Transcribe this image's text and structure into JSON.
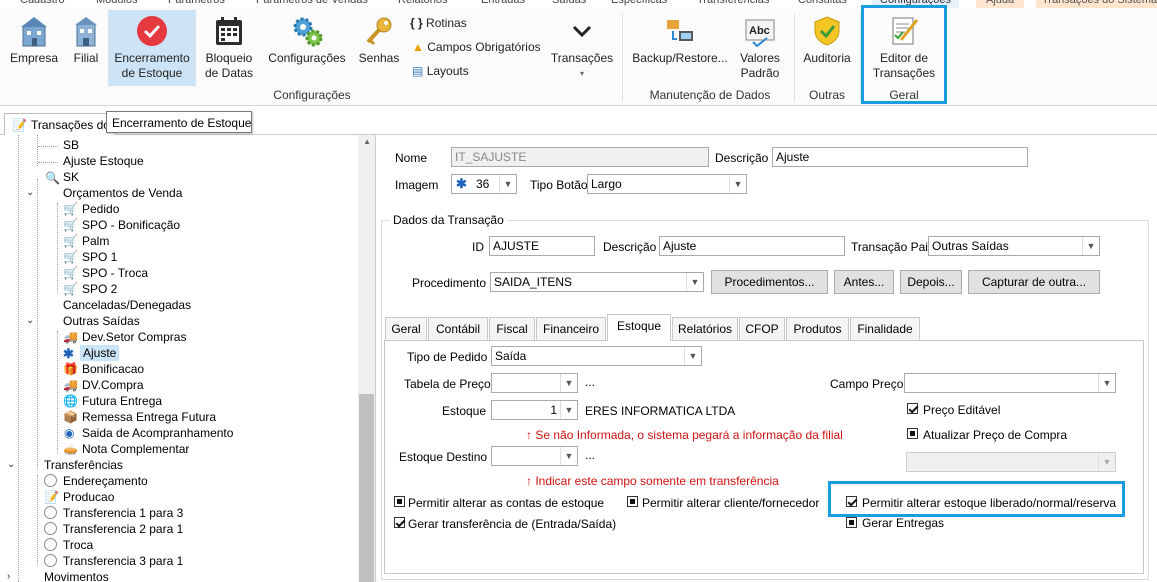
{
  "menu_tabs": [
    "Cadastro",
    "Módulos",
    "Parâmetros",
    "Parâmetros de Vendas",
    "Relatórios",
    "Entradas",
    "Saídas",
    "Específicas",
    "Transferências",
    "Consultas",
    "Configurações",
    "Ajuda",
    "Transações do Sistema"
  ],
  "ribbon": {
    "buttons": {
      "empresa": "Empresa",
      "filial": "Filial",
      "encerramento": [
        "Encerramento",
        "de Estoque"
      ],
      "bloqueio": [
        "Bloqueio",
        "de Datas"
      ],
      "configuracoes": "Configurações",
      "senhas": "Senhas",
      "transacoes": "Transações",
      "backup": "Backup/Restore...",
      "valores": [
        "Valores",
        "Padrão"
      ],
      "auditoria": "Auditoria",
      "editor": [
        "Editor de",
        "Transações"
      ]
    },
    "small_items": {
      "rotinas": "Rotinas",
      "campos": "Campos Obrigatórios",
      "layouts": "Layouts"
    },
    "groups": {
      "configuracoes": "Configurações",
      "manutencao": "Manutenção de Dados",
      "outras": "Outras",
      "geral": "Geral"
    },
    "abc_icon_text": "Abc"
  },
  "doc_tab": "Transações do Sistema",
  "tooltip": "Encerramento de Estoque",
  "tree": [
    {
      "label": "SB"
    },
    {
      "label": "Ajuste Estoque"
    },
    {
      "label": "SK"
    },
    {
      "label": "Orçamentos de Venda"
    },
    {
      "label": "Pedido"
    },
    {
      "label": "SPO - Bonificação"
    },
    {
      "label": "Palm"
    },
    {
      "label": "SPO 1"
    },
    {
      "label": "SPO - Troca"
    },
    {
      "label": "SPO 2"
    },
    {
      "label": "Canceladas/Denegadas"
    },
    {
      "label": "Outras Saídas"
    },
    {
      "label": "Dev.Setor Compras"
    },
    {
      "label": "Ajuste"
    },
    {
      "label": "Bonificacao"
    },
    {
      "label": "DV.Compra"
    },
    {
      "label": "Futura Entrega"
    },
    {
      "label": "Remessa Entrega Futura"
    },
    {
      "label": "Saida de Acompranhamento"
    },
    {
      "label": "Nota Complementar"
    },
    {
      "label": "Transferências"
    },
    {
      "label": "Endereçamento"
    },
    {
      "label": "Producao"
    },
    {
      "label": "Transferencia 1 para 3"
    },
    {
      "label": "Transferencia 2 para 1"
    },
    {
      "label": "Troca"
    },
    {
      "label": "Transferencia 3 para 1"
    },
    {
      "label": "Movimentos"
    }
  ],
  "form": {
    "nome_label": "Nome",
    "nome_value": "IT_SAJUSTE",
    "descricao_label": "Descrição",
    "descricao_value": "Ajuste",
    "imagem_label": "Imagem",
    "imagem_value": "36",
    "tipo_botao_label": "Tipo Botão",
    "tipo_botao_value": "Largo",
    "dados_title": "Dados da Transação",
    "id_label": "ID",
    "id_value": "AJUSTE",
    "desc2_label": "Descrição",
    "desc2_value": "Ajuste",
    "pai_label": "Transação Pai",
    "pai_value": "Outras Saídas",
    "proc_label": "Procedimento",
    "proc_value": "SAIDA_ITENS",
    "btn_procedimentos": "Procedimentos...",
    "btn_antes": "Antes...",
    "btn_depois": "Depois...",
    "btn_capturar": "Capturar de outra..."
  },
  "tabs": [
    "Geral",
    "Contábil",
    "Fiscal",
    "Financeiro",
    "Estoque",
    "Relatórios",
    "CFOP",
    "Produtos",
    "Finalidade"
  ],
  "estoque": {
    "tipo_pedido_label": "Tipo de Pedido",
    "tipo_pedido_value": "Saída",
    "tabela_preco_label": "Tabela de Preço",
    "ellipsis": "...",
    "campo_preco_label": "Campo Preço",
    "estoque_label": "Estoque",
    "estoque_value": "1",
    "estoque_empresa": "ERES INFORMATICA LTDA",
    "preco_editavel": "Preço Editável",
    "warn_estoque": "↑ Se não Informada, o sistema pegará a informação da filial",
    "atualizar_preco": "Atualizar Preço de Compra",
    "estoque_destino_label": "Estoque Destino",
    "warn_destino": "↑ Indicar este campo somente em transferência",
    "perm_contas": "Permitir alterar as contas de estoque",
    "perm_cliente": "Permitir alterar cliente/fornecedor",
    "perm_estoque": "Permitir alterar estoque liberado/normal/reserva",
    "gerar_transf": "Gerar transferência de (Entrada/Saída)",
    "gerar_entregas": "Gerar Entregas"
  },
  "colors": {
    "highlight": "#1b9be0",
    "selected": "#cde4f7",
    "warning": "#d01010"
  }
}
